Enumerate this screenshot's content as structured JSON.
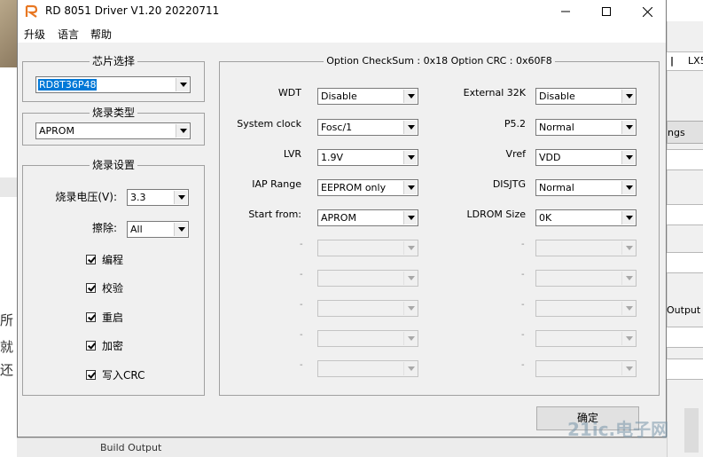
{
  "background": {
    "left_text": [
      "所",
      "就",
      "还"
    ],
    "right_tab_a": "|",
    "right_tab_b": "LX5",
    "right_button": "ngs",
    "right_label": "Output F",
    "bottom_bar": "Build Output",
    "watermark": "21ic.电子网"
  },
  "window": {
    "title": "RD 8051 Driver V1.20 20220711",
    "controls": {
      "minimize": "minimize-icon",
      "maximize": "maximize-icon",
      "close": "close-icon"
    }
  },
  "menu": [
    "升级",
    "语言",
    "帮助"
  ],
  "chip_select": {
    "title": "芯片选择",
    "value": "RD8T36P48"
  },
  "burn_type": {
    "title": "烧录类型",
    "value": "APROM"
  },
  "burn_settings": {
    "title": "烧录设置",
    "voltage_label": "烧录电压(V):",
    "voltage_value": "3.3",
    "erase_label": "擦除:",
    "erase_value": "All",
    "checkboxes": [
      {
        "label": "编程",
        "checked": true
      },
      {
        "label": "校验",
        "checked": true
      },
      {
        "label": "重启",
        "checked": true
      },
      {
        "label": "加密",
        "checked": true
      },
      {
        "label": "写入CRC",
        "checked": true
      }
    ]
  },
  "options": {
    "title": "Option CheckSum : 0x18  Option CRC : 0x60F8",
    "left": [
      {
        "label": "WDT",
        "value": "Disable"
      },
      {
        "label": "System clock",
        "value": "Fosc/1"
      },
      {
        "label": "LVR",
        "value": "1.9V"
      },
      {
        "label": "IAP Range",
        "value": "EEPROM only"
      },
      {
        "label": "Start from:",
        "value": "APROM"
      }
    ],
    "right": [
      {
        "label": "External 32K",
        "value": "Disable"
      },
      {
        "label": "P5.2",
        "value": "Normal"
      },
      {
        "label": "Vref",
        "value": "VDD"
      },
      {
        "label": "DISJTG",
        "value": "Normal"
      },
      {
        "label": "LDROM Size",
        "value": "0K"
      }
    ],
    "disabled_label": "-"
  },
  "ok_button": "确定"
}
